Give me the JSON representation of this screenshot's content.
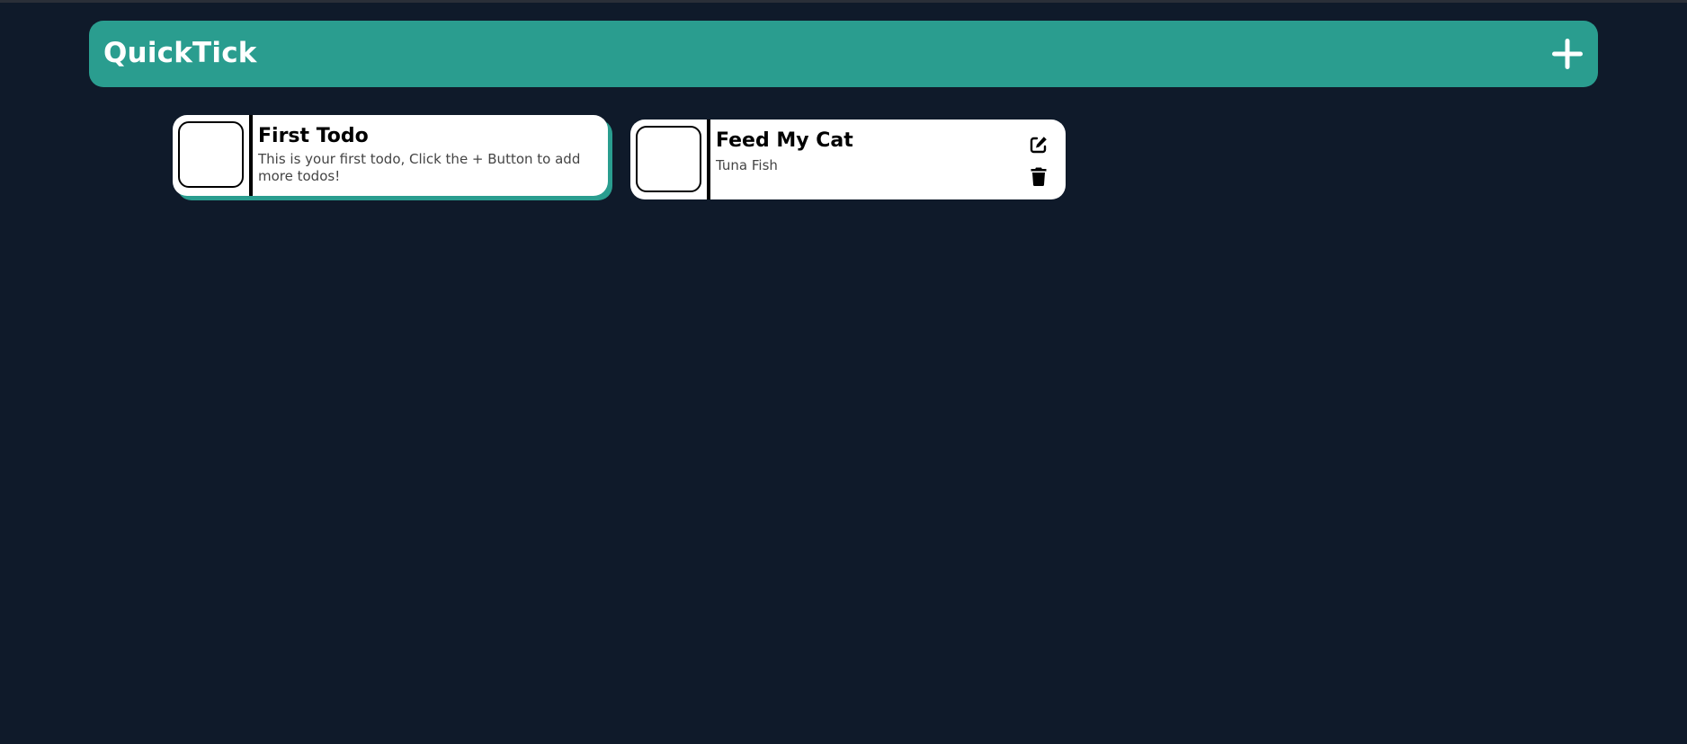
{
  "header": {
    "title": "QuickTick",
    "add_icon": "plus-icon",
    "color": "#2a9d8f"
  },
  "todos": [
    {
      "title": "First Todo",
      "description": "This is your first todo, Click the + Button to add more todos!",
      "completed": false
    },
    {
      "title": "Feed My Cat",
      "description": "Tuna Fish",
      "completed": false,
      "actions": [
        "edit-icon",
        "trash-icon"
      ]
    }
  ],
  "colors": {
    "background": "#0f1a2a",
    "accent": "#2a9d8f",
    "card": "#ffffff"
  }
}
